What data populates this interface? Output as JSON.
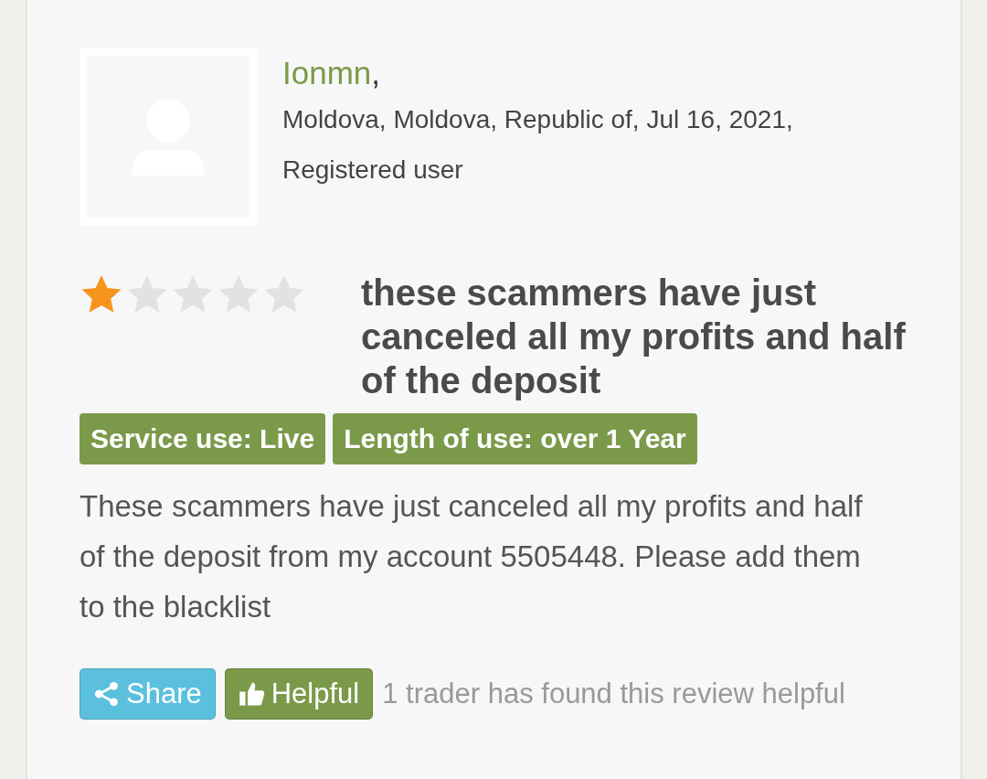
{
  "review": {
    "author": "Ionmn",
    "author_separator": ",",
    "meta_lines": [
      "Moldova, Moldova, Republic of, Jul 16, 2021,",
      "Registered user"
    ],
    "stars": 1,
    "title": "these scammers have just canceled all my profits and half of the deposit",
    "badges": [
      "Service use: Live",
      "Length of use: over 1 Year"
    ],
    "body": "These scammers have just canceled all my profits and half of the deposit from my account 5505448. Please add them to the blacklist",
    "actions": [
      {
        "kind": "share",
        "label": "Share"
      },
      {
        "kind": "helpful",
        "label": "Helpful"
      }
    ],
    "helpful_count": "1 trader has found this review helpful"
  }
}
